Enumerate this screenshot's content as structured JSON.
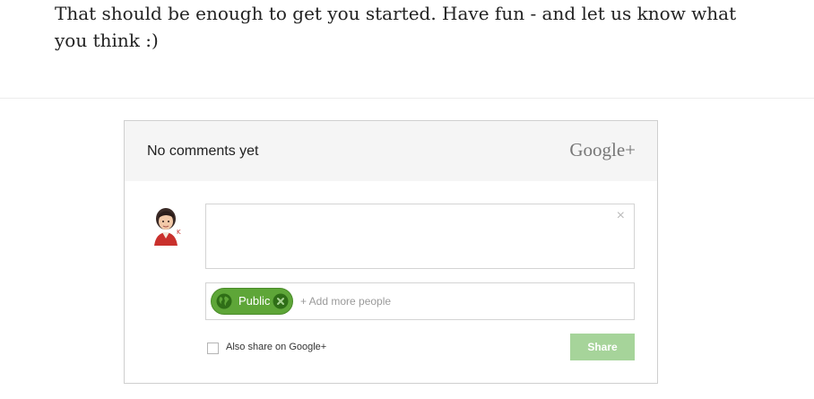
{
  "article": {
    "text": "That should be enough to get you started. Have fun - and let us know what you think :)"
  },
  "comments_widget": {
    "header": {
      "count_text": "No comments yet",
      "brand": "Google+"
    },
    "comment_box": {
      "value": "",
      "close_symbol": "×"
    },
    "audience": {
      "chip_label": "Public",
      "chip_icon": "globe-icon",
      "remove_icon": "remove-circle-icon",
      "add_placeholder": "+ Add more people"
    },
    "also_share": {
      "label": "Also share on Google+",
      "checked": false
    },
    "share_button": {
      "label": "Share",
      "enabled": false
    },
    "colors": {
      "header_bg": "#f5f5f5",
      "chip_green": "#5ea638",
      "share_disabled": "#a6d49a",
      "brand_gray": "#777777"
    }
  }
}
